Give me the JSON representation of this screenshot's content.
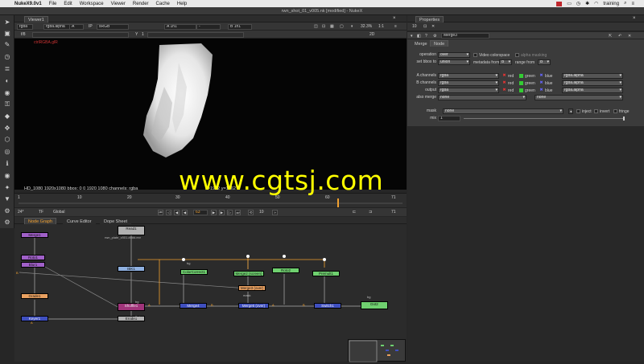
{
  "menubar": {
    "app_name": "NukeX9.0v1",
    "items": [
      "File",
      "Edit",
      "Workspace",
      "Viewer",
      "Render",
      "Cache",
      "Help"
    ],
    "user": "training"
  },
  "window": {
    "title": "rwn_shot_01_v005.nk [modified] - NukeX"
  },
  "viewer": {
    "tab_label": "Viewer1",
    "channels": "rgba",
    "display": "rgba.alpha",
    "input_a": "A",
    "ip_label": "IP",
    "colorspace": "sRGB",
    "a_node": "A 1n1",
    "blend_mode": "-",
    "b_node": "B 1n1",
    "zoom": "32.3%",
    "ratio": "1:1",
    "mode": "2D",
    "frame_prefix": "f/8",
    "y_label": "Y",
    "y_value": "1",
    "red_label": "ctrlRGBA.glR",
    "info": "HD_1080 1920x1080  bbox: 0 0 1920 1080 channels: rgba",
    "pixel_readout": "x=1962 y=1062"
  },
  "timeline": {
    "ticks": [
      "1",
      "10",
      "20",
      "30",
      "40",
      "50",
      "60",
      "71"
    ],
    "end_frame": "71",
    "fps": "24*",
    "tf": "TF",
    "scope": "Global",
    "current_frame": "63",
    "step": "10",
    "out_frame": "71"
  },
  "nodegraph": {
    "tabs": [
      "Node Graph",
      "Curve Editor",
      "Dope Sheet"
    ],
    "nodes": [
      {
        "label": "Read1",
        "sub": "rwn_plate_v001.####.exr"
      },
      {
        "label": "Merge1"
      },
      {
        "label": "Roto1"
      },
      {
        "label": "Blur1"
      },
      {
        "label": "Grade1"
      },
      {
        "label": "Dot"
      },
      {
        "label": "Keyer1"
      },
      {
        "label": "IBK1"
      },
      {
        "label": "Shuffle1"
      },
      {
        "label": "Erode1"
      },
      {
        "label": "Merge2 (screen)"
      },
      {
        "label": "Roto2"
      },
      {
        "label": "Merge3 (over)"
      },
      {
        "label": "Merge4"
      },
      {
        "label": "Merge5 (over)"
      },
      {
        "label": "ColorCorrect1"
      },
      {
        "label": "Premult1"
      },
      {
        "label": "Switch1"
      },
      {
        "label": "Dot2"
      }
    ],
    "edge_labels": [
      "A",
      "B",
      "A",
      "B",
      "A",
      "B",
      "mask"
    ],
    "bg_labels": [
      "bg",
      "bg",
      "bg"
    ]
  },
  "properties": {
    "tab_label": "Properties",
    "count": "10",
    "node_name": "Merge3",
    "subtabs": [
      "Merge",
      "Node"
    ],
    "operation_label": "operation",
    "operation_value": "over",
    "video_colorspace_label": "Video colorspace",
    "alpha_masking_label": "alpha masking",
    "set_bbox_label": "set bbox to",
    "set_bbox_value": "union",
    "metadata_label": "metadata from",
    "metadata_value": "B",
    "range_label": "range from",
    "range_value": "B",
    "a_channels_label": "A channels",
    "a_channels_value": "rgba",
    "b_channels_label": "B channels",
    "b_channels_value": "rgba",
    "output_label": "output",
    "output_value": "rgba",
    "also_merge_label": "also merge",
    "also_merge_value": "none",
    "also_merge_value2": "none",
    "alpha_dd": "rgba.alpha",
    "chan_red": "red",
    "chan_green": "green",
    "chan_blue": "blue",
    "mask_label": "mask",
    "mask_value": "none",
    "mask_value2": "none",
    "inject_label": "inject",
    "invert_label": "invert",
    "fringe_label": "fringe",
    "mix_label": "mix",
    "mix_value": "1"
  },
  "colors": {
    "accent": "#f0a030",
    "watermark": "#ffff00",
    "node_merge": "#3f4fbf",
    "node_roto": "#6fd06f",
    "node_read": "#b0b0b0",
    "node_grade": "#e8a060",
    "node_purple": "#a060c8"
  }
}
